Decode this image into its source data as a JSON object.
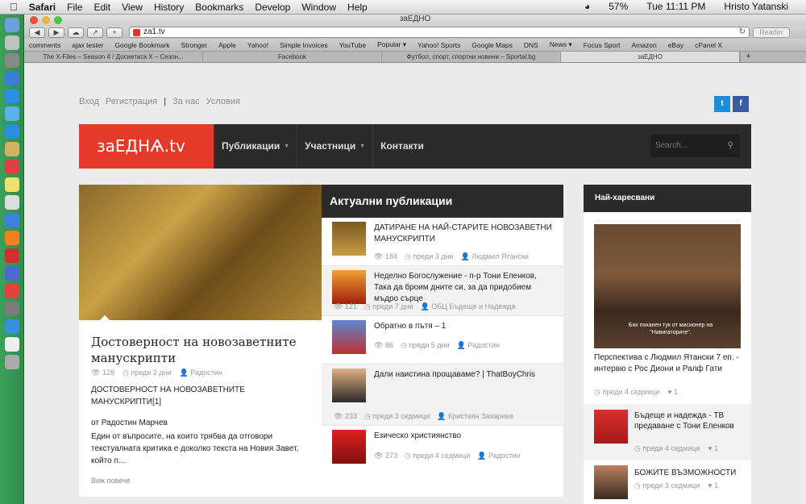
{
  "menubar": {
    "app": "Safari",
    "items": [
      "File",
      "Edit",
      "View",
      "History",
      "Bookmarks",
      "Develop",
      "Window",
      "Help"
    ],
    "battery": "57%",
    "clock": "Tue 11:11 PM",
    "user": "Hristo Yatanski"
  },
  "window": {
    "title": "заЕДНО"
  },
  "toolbar": {
    "url": "za1.tv",
    "reader": "Reader"
  },
  "bookmarks": [
    "comments",
    "ajax tester",
    "Google Bookmark",
    "Stronger",
    "Apple",
    "Yahoo!",
    "Simple Invoices",
    "YouTube",
    "Popular ▾",
    "Yahoo! Sports",
    "Google Maps",
    "DNS",
    "News ▾",
    "Focus Sport",
    "Amazon",
    "eBay",
    "cPanel X"
  ],
  "tabs": [
    "The X-Files – Season 4 / Досиетата Х – Сезон...",
    "Facebook",
    "Футбол, спорт, спортни новини – Sportal.bg",
    "заЕДНО"
  ],
  "topnav": {
    "login": "Вход",
    "register": "Регистрация",
    "sep": "|",
    "about": "За нас",
    "terms": "Условия"
  },
  "social": {
    "twitter": "t",
    "facebook": "f"
  },
  "header": {
    "logo": "заЕДНѦ.tv",
    "nav": [
      "Публикации",
      "Участници",
      "Контакти"
    ],
    "search_placeholder": "Search..."
  },
  "featured": {
    "title": "Достоверност на новозаветните манускрипти",
    "views": "128",
    "date": "преди 2 дни",
    "author": "Радостин",
    "body1": "ДОСТОВЕРНОСТ НА НОВОЗАВЕТНИТЕ МАНУСКРИПТИ[1]",
    "body2": "от Радостин Марчев",
    "body3": "Един от въпросите, на които трябва да отговори текстуалната критика е доколко текста на Новия Завет, който п…",
    "more": "Виж повече"
  },
  "latest": {
    "heading": "Актуални публикации",
    "items": [
      {
        "title": "ДАТИРАНЕ НА НАЙ-СТАРИТЕ НОВОЗАВЕТНИ МАНУСКРИПТИ",
        "views": "184",
        "date": "преди 3 дни",
        "author": "Людмил Ятански"
      },
      {
        "title": "Неделно Богослужение - п-р Тони Еленков, Така да броим дните си, за да придобием мъдро сърце",
        "views": "121",
        "date": "преди 7 дни",
        "author": "ОБЦ Бъдеще и Надежда"
      },
      {
        "title": "Обратно в пътя – 1",
        "views": "86",
        "date": "преди 5 дни",
        "author": "Радостин"
      },
      {
        "title": "Дали наистина прощаваме? | ThatBoyChris",
        "views": "233",
        "date": "преди 3 седмици",
        "author": "Кристиян Захариев"
      },
      {
        "title": "Езическо християнство",
        "views": "273",
        "date": "преди 4 седмици",
        "author": "Радостин"
      }
    ]
  },
  "popular": {
    "heading": "Най-харесвани",
    "caption": "Бях поканен тук от мисионер на \"Навигаторите\".",
    "items": [
      {
        "title": "Перспектива с Людмил Ятански 7 еп. - интервю с Рос Диони и Ралф Гати",
        "date": "преди 4 седмици",
        "likes": "1"
      },
      {
        "title": "Бъдеще и надежда - ТВ предаване с Тони Еленков",
        "date": "преди 4 седмици",
        "likes": "1"
      },
      {
        "title": "БОЖИТЕ ВЪЗМОЖНОСТИ",
        "date": "преди 3 седмици",
        "likes": "1"
      }
    ]
  }
}
